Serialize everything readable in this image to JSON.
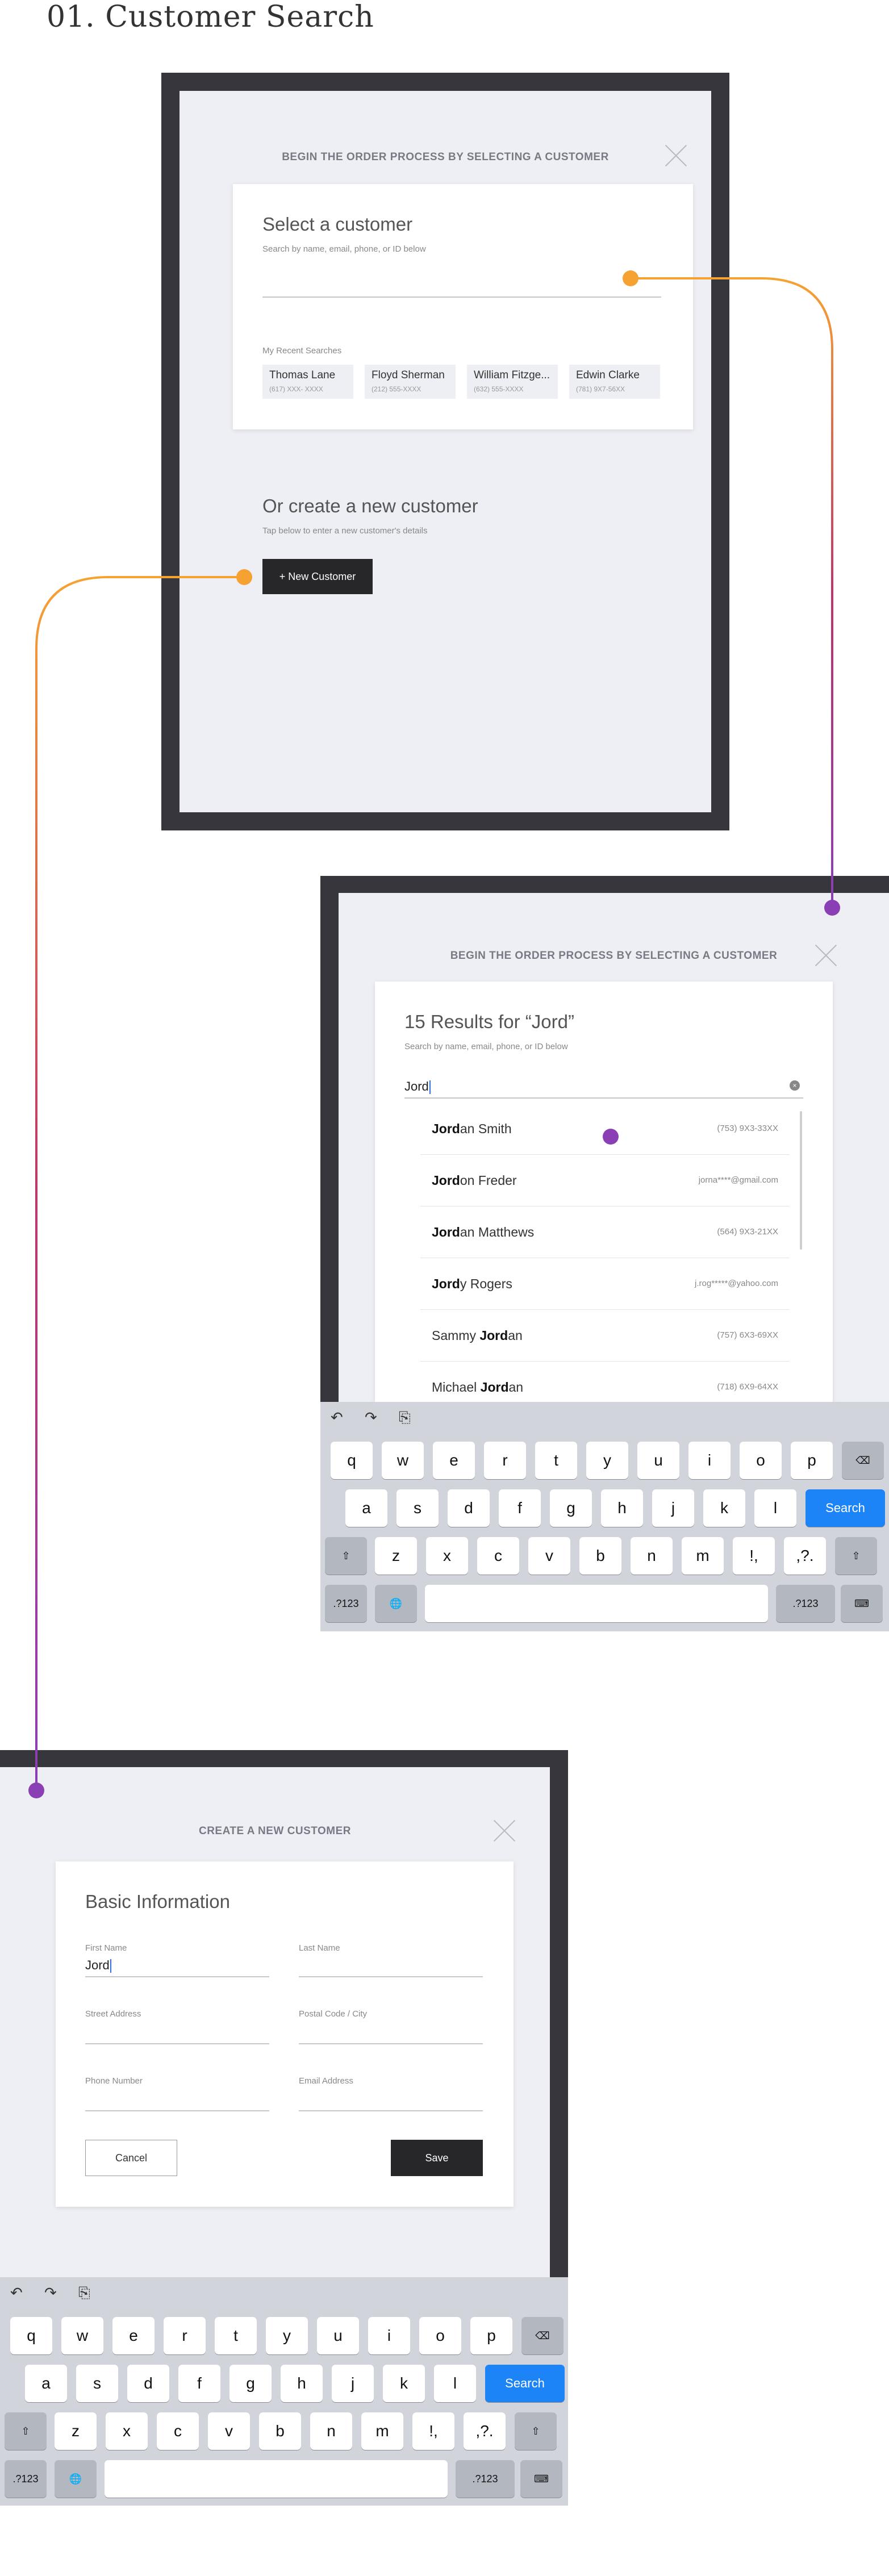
{
  "page_title": "01. Customer Search",
  "screen1": {
    "header": "BEGIN THE ORDER PROCESS BY SELECTING A CUSTOMER",
    "card_title": "Select a customer",
    "card_subtitle": "Search by name, email, phone, or ID below",
    "search_placeholder": "",
    "recent_label": "My Recent Searches",
    "recent": [
      {
        "name": "Thomas Lane",
        "phone": "(617) XXX- XXXX"
      },
      {
        "name": "Floyd Sherman",
        "phone": "(212) 555-XXXX"
      },
      {
        "name": "William Fitzge...",
        "phone": "(632) 555-XXXX"
      },
      {
        "name": "Edwin Clarke",
        "phone": "(781) 9X7-56XX"
      }
    ],
    "new_title": "Or create a new customer",
    "new_subtitle": "Tap below to enter a new customer's details",
    "new_button": "+ New Customer"
  },
  "screen2": {
    "header": "BEGIN THE ORDER PROCESS BY SELECTING A CUSTOMER",
    "card_title": "15 Results for “Jord”",
    "card_subtitle": "Search by name, email, phone, or ID below",
    "search_value": "Jord",
    "results": [
      {
        "bold": "Jord",
        "rest": "an Smith",
        "pre": "",
        "contact": "(753) 9X3-33XX"
      },
      {
        "bold": "Jord",
        "rest": "on Freder",
        "pre": "",
        "contact": "jorna****@gmail.com"
      },
      {
        "bold": "Jord",
        "rest": "an Matthews",
        "pre": "",
        "contact": "(564) 9X3-21XX"
      },
      {
        "bold": "Jord",
        "rest": "y Rogers",
        "pre": "",
        "contact": "j.rog*****@yahoo.com"
      },
      {
        "bold": "Jord",
        "rest": "an",
        "pre": "Sammy ",
        "contact": "(757) 6X3-69XX"
      },
      {
        "bold": "Jord",
        "rest": "an",
        "pre": "Michael ",
        "contact": "(718) 6X9-64XX"
      }
    ]
  },
  "screen3": {
    "header": "CREATE A NEW CUSTOMER",
    "card_title": "Basic Information",
    "fields": {
      "first_name_label": "First Name",
      "first_name_value": "Jord",
      "last_name_label": "Last Name",
      "last_name_value": "",
      "street_label": "Street Address",
      "postal_label": "Postal Code / City",
      "phone_label": "Phone Number",
      "email_label": "Email Address"
    },
    "cancel_button": "Cancel",
    "save_button": "Save"
  },
  "keyboard": {
    "row1": [
      "q",
      "w",
      "e",
      "r",
      "t",
      "y",
      "u",
      "i",
      "o",
      "p"
    ],
    "row2": [
      "a",
      "s",
      "d",
      "f",
      "g",
      "h",
      "j",
      "k",
      "l"
    ],
    "row3": [
      "z",
      "x",
      "c",
      "v",
      "b",
      "n",
      "m",
      "!,",
      ",?."
    ],
    "search_key": "Search",
    "numbers_key": ".?123",
    "toolbar_icons": [
      "undo-icon",
      "redo-icon",
      "paste-icon"
    ]
  },
  "colors": {
    "frame": "#37363c",
    "screen_bg": "#eeeff4",
    "accent_orange": "#f6a233",
    "accent_purple": "#8a3fb5",
    "search_key_blue": "#1c84f7",
    "primary_button": "#27272a"
  }
}
